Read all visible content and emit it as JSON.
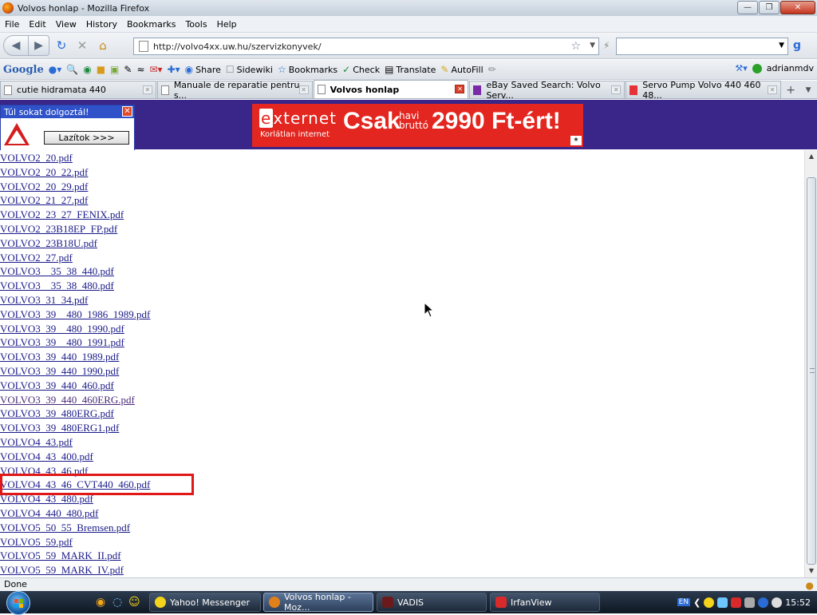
{
  "window": {
    "title": "Volvos honlap - Mozilla Firefox",
    "buttons": [
      "minimize",
      "maximize",
      "close"
    ]
  },
  "menubar": [
    "File",
    "Edit",
    "View",
    "History",
    "Bookmarks",
    "Tools",
    "Help"
  ],
  "navbar": {
    "url": "http://volvo4xx.uw.hu/szervizkonyvek/",
    "search_value": ""
  },
  "google_toolbar": {
    "logo": "Google",
    "share_label": "Share",
    "sidewiki_label": "Sidewiki",
    "bookmarks_label": "Bookmarks",
    "check_label": "Check",
    "translate_label": "Translate",
    "autofill_label": "AutoFill",
    "user": "adrianmdv"
  },
  "tabs": [
    {
      "label": "cutie hidramata 440",
      "active": false
    },
    {
      "label": "Manuale de reparatie pentru s...",
      "active": false
    },
    {
      "label": "Volvos honlap",
      "active": true
    },
    {
      "label": "eBay Saved Search: Volvo Serv...",
      "active": false
    },
    {
      "label": "Servo Pump Volvo 440 460 48...",
      "active": false
    }
  ],
  "banner": {
    "warning_title": "Túl sokat dolgoztál!",
    "warning_button": "Lazítok >>>",
    "ad_brand_e": "e",
    "ad_brand_rest": "xternet",
    "ad_sub": "Korlátlan internet",
    "ad_big": "Csak",
    "ad_small1": "havi",
    "ad_small2": "bruttó",
    "ad_price": "2990 Ft-ért!"
  },
  "files": [
    "VOLVO2_20.pdf",
    "VOLVO2_20_22.pdf",
    "VOLVO2_20_29.pdf",
    "VOLVO2_21_27.pdf",
    "VOLVO2_23_27_FENIX.pdf",
    "VOLVO2_23B18EP_FP.pdf",
    "VOLVO2_23B18U.pdf",
    "VOLVO2_27.pdf",
    "VOLVO3__35_38_440.pdf",
    "VOLVO3__35_38_480.pdf",
    "VOLVO3_31_34.pdf",
    "VOLVO3_39__480_1986_1989.pdf",
    "VOLVO3_39__480_1990.pdf",
    "VOLVO3_39__480_1991.pdf",
    "VOLVO3_39_440_1989.pdf",
    "VOLVO3_39_440_1990.pdf",
    "VOLVO3_39_440_460.pdf",
    "VOLVO3_39_440_460ERG.pdf",
    "VOLVO3_39_480ERG.pdf",
    "VOLVO3_39_480ERG1.pdf",
    "VOLVO4_43.pdf",
    "VOLVO4_43_400.pdf",
    "VOLVO4_43_46.pdf",
    "VOLVO4_43_46_CVT440_460.pdf",
    "VOLVO4_43_480.pdf",
    "VOLVO4_440_480.pdf",
    "VOLVO5_50_55_Bremsen.pdf",
    "VOLVO5_59.pdf",
    "VOLVO5_59_MARK_II.pdf",
    "VOLVO5_59_MARK_IV.pdf"
  ],
  "highlighted_file_index": 23,
  "status": "Done",
  "taskbar": {
    "tasks": [
      "Yahoo! Messenger",
      "Volvos honlap - Moz...",
      "VADIS",
      "IrfanView"
    ],
    "active_task": 1,
    "language": "EN",
    "clock": "15:52"
  },
  "colors": {
    "link": "#1a1a8a",
    "highlight_border": "#e01818",
    "banner_bg": "#3a2588",
    "ad_bg": "#e3261f"
  }
}
